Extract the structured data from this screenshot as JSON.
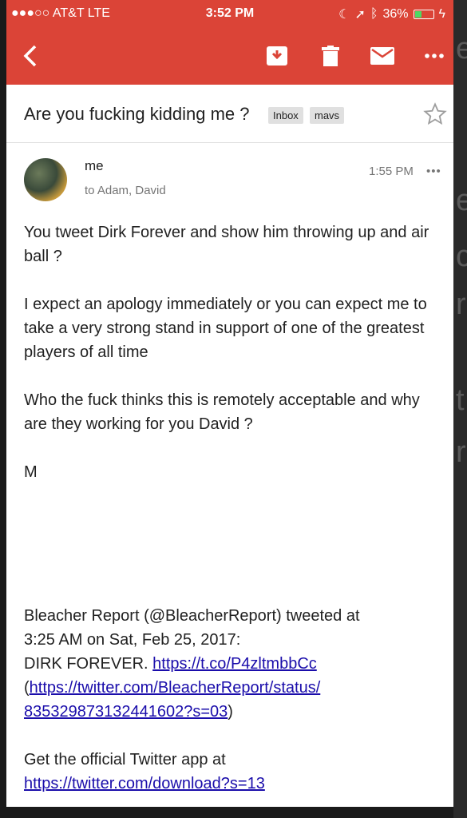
{
  "status_bar": {
    "carrier": "●●●○○ AT&T  LTE",
    "time": "3:52 PM",
    "battery": "36%"
  },
  "subject": "Are you fucking kidding me ?",
  "labels": [
    "Inbox",
    "mavs"
  ],
  "message": {
    "sender": "me",
    "recipients": "to Adam, David",
    "time": "1:55 PM",
    "paragraphs": [
      "You tweet Dirk Forever and show him throwing up and air ball ?",
      "I expect an apology immediately or you can expect me to take a very strong stand in support of one of the greatest players of all time",
      "Who the fuck thinks this is remotely acceptable and why are they working for you David ?",
      "M"
    ],
    "tweet_line1": "Bleacher Report (@BleacherReport) tweeted at",
    "tweet_line2": "3:25 AM on Sat, Feb 25, 2017:",
    "tweet_text": "DIRK FOREVER.",
    "tweet_link": "https://t.co/P4zltmbbCc",
    "status_link_1": "https://twitter.com/BleacherReport/status/",
    "status_link_2": "835329873132441602?s=03",
    "app_line": "Get the official Twitter app at",
    "app_link": "https://twitter.com/download?s=13"
  },
  "colors": {
    "accent": "#db4437",
    "link": "#1a0dab"
  }
}
